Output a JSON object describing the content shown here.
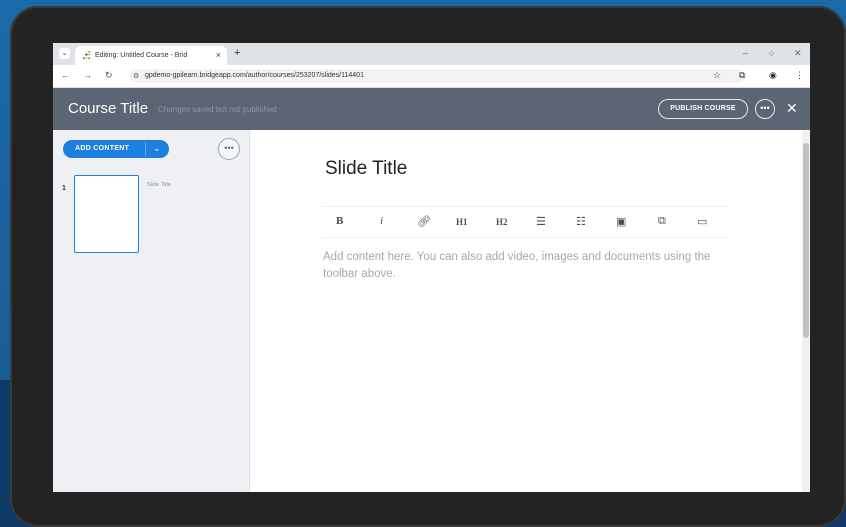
{
  "browser": {
    "tab_title": "Editing: Untitled Course - Brid",
    "tab_close": "×",
    "new_tab": "+",
    "url": "gpdemo-gpilearn.bridgeapp.com/author/courses/253207/slides/114401",
    "minimize": "–",
    "restore": "○",
    "close": "✕"
  },
  "header": {
    "course_title": "Course Title",
    "save_status": "Changes saved but not published",
    "publish_label": "PUBLISH COURSE",
    "more_label": "•••",
    "close_label": "✕"
  },
  "sidebar": {
    "add_content_label": "ADD CONTENT",
    "more_label": "•••",
    "slides": [
      {
        "number": "1",
        "title": "Slide Title"
      }
    ]
  },
  "editor": {
    "slide_title": "Slide Title",
    "toolbar": {
      "bold": "B",
      "italic": "i",
      "h1": "H1",
      "h2": "H2"
    },
    "placeholder": "Add content here. You can also add video, images and documents using the toolbar above."
  },
  "colors": {
    "accent": "#1f7fe0",
    "header_bg": "#5b6573",
    "sidebar_bg": "#eef0f3"
  }
}
